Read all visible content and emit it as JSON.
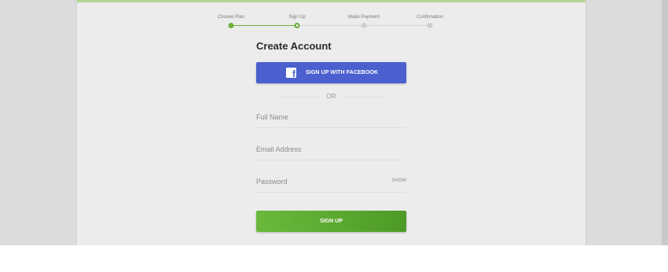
{
  "stepper": {
    "steps": [
      {
        "label": "Choose Plan",
        "state": "done"
      },
      {
        "label": "Sign Up",
        "state": "current"
      },
      {
        "label": "Make Payment",
        "state": "todo"
      },
      {
        "label": "Confirmation",
        "state": "todo"
      }
    ],
    "colors": {
      "active": "#6cae3a",
      "inactive": "#cfcfcf"
    }
  },
  "form": {
    "title": "Create Account",
    "facebook_button": {
      "label": "SIGN UP WITH FACEBOOK",
      "icon": "facebook-icon",
      "icon_glyph": "f",
      "color": "#4b5fcf"
    },
    "divider_text": "OR",
    "fields": {
      "full_name": {
        "placeholder": "Full Name",
        "value": ""
      },
      "email": {
        "placeholder": "Email Address",
        "value": ""
      },
      "password": {
        "placeholder": "Password",
        "value": "",
        "toggle_label": "SHOW"
      }
    },
    "signup_button": {
      "label": "SIGN UP",
      "color": "#5aa82f"
    }
  }
}
